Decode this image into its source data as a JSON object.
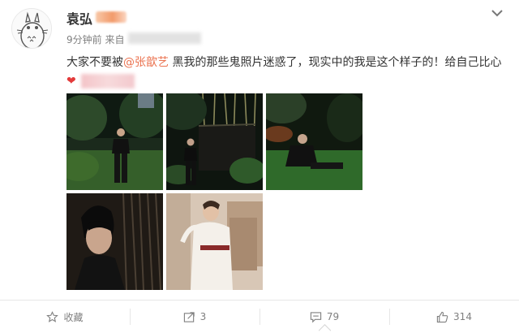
{
  "post": {
    "username": "袁弘",
    "time": "9分钟前",
    "source_prefix": "来自",
    "text_before": "大家不要被",
    "mention": "@张歆艺",
    "text_after": " 黑我的那些鬼照片迷惑了，现实中的我是这个样子的！给自己比心",
    "heart": "❤"
  },
  "photos": [
    {
      "subject": "man standing in dark garden"
    },
    {
      "subject": "man by bamboo fence at night"
    },
    {
      "subject": "man seated in garden at night"
    },
    {
      "subject": "close-up portrait of man"
    },
    {
      "subject": "woman in white dress seated"
    }
  ],
  "actions": {
    "favorite_label": "收藏",
    "repost_count": "3",
    "comment_count": "79",
    "like_count": "314"
  },
  "icons": {
    "avatar": "totoro-avatar-icon",
    "menu": "chevron-down-icon",
    "favorite": "star-icon",
    "repost": "repost-icon",
    "comment": "comment-icon",
    "like": "thumbs-up-icon"
  },
  "colors": {
    "mention": "#eb7350",
    "heart": "#e33a3a",
    "meta_text": "#808080"
  }
}
